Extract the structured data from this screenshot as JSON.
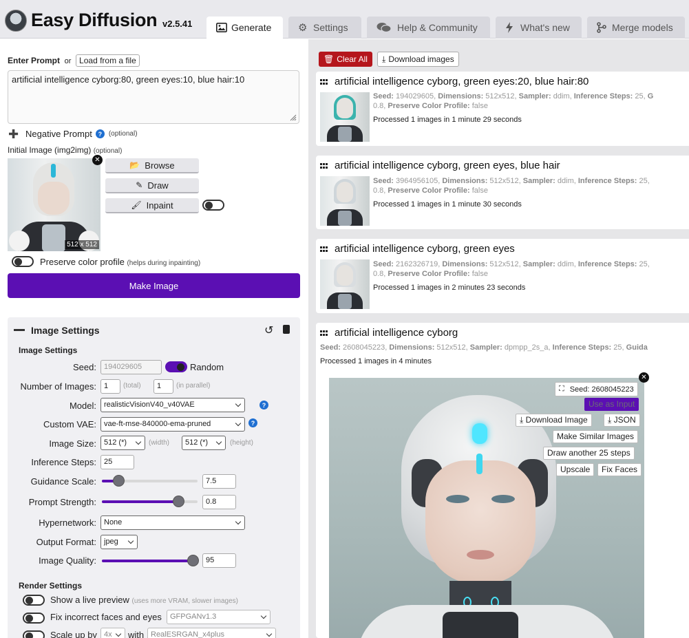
{
  "header": {
    "app_title": "Easy Diffusion",
    "version": "v2.5.41",
    "tabs": [
      {
        "label": "Generate",
        "icon": "image-icon"
      },
      {
        "label": "Settings",
        "icon": "gear-icon"
      },
      {
        "label": "Help & Community",
        "icon": "comments-icon"
      },
      {
        "label": "What's new",
        "icon": "bolt-icon"
      },
      {
        "label": "Merge models",
        "icon": "code-branch-icon"
      }
    ]
  },
  "prompt": {
    "label": "Enter Prompt",
    "or": "or",
    "load_button": "Load from a file",
    "value": "artificial intelligence cyborg:80, green eyes:10, blue hair:10",
    "negative_label": "Negative Prompt",
    "negative_hint": "(optional)"
  },
  "initial_image": {
    "label": "Initial Image (img2img)",
    "hint": "(optional)",
    "size_badge": "512 x 512",
    "browse": "Browse",
    "draw": "Draw",
    "inpaint": "Inpaint",
    "preserve_label": "Preserve color profile",
    "preserve_hint": "(helps during inpainting)"
  },
  "make_image": "Make Image",
  "image_settings": {
    "panel_title": "Image Settings",
    "section_title": "Image Settings",
    "seed_label": "Seed:",
    "seed_value": "194029605",
    "random_label": "Random",
    "num_images_label": "Number of Images:",
    "num_total": "1",
    "num_total_hint": "(total)",
    "num_parallel": "1",
    "num_parallel_hint": "(in parallel)",
    "model_label": "Model:",
    "model_value": "realisticVisionV40_v40VAE",
    "vae_label": "Custom VAE:",
    "vae_value": "vae-ft-mse-840000-ema-pruned",
    "size_label": "Image Size:",
    "width_value": "512 (*)",
    "width_hint": "(width)",
    "height_value": "512 (*)",
    "height_hint": "(height)",
    "steps_label": "Inference Steps:",
    "steps_value": "25",
    "guidance_label": "Guidance Scale:",
    "guidance_value": "7.5",
    "guidance_fraction": 0.17,
    "strength_label": "Prompt Strength:",
    "strength_value": "0.8",
    "strength_fraction": 0.8,
    "hypernetwork_label": "Hypernetwork:",
    "hypernetwork_value": "None",
    "format_label": "Output Format:",
    "format_value": "jpeg",
    "quality_label": "Image Quality:",
    "quality_value": "95",
    "quality_fraction": 0.95
  },
  "render_settings": {
    "title": "Render Settings",
    "live_preview_label": "Show a live preview",
    "live_preview_hint": "(uses more VRAM, slower images)",
    "fix_faces_label": "Fix incorrect faces and eyes",
    "fix_faces_model": "GFPGANv1.3",
    "scale_label": "Scale up by",
    "scale_value": "4x",
    "scale_with": "with",
    "scale_model": "RealESRGAN_x4plus"
  },
  "results_toolbar": {
    "clear_all": "Clear All",
    "download_images": "Download images"
  },
  "results": [
    {
      "title": "artificial intelligence cyborg, green eyes:20, blue hair:80",
      "seed": "194029605",
      "dimensions": "512x512",
      "sampler": "ddim",
      "steps": "25",
      "guidance_trunc": "G",
      "strength_tail": "0.8",
      "preserve": "false",
      "processed": "Processed 1 images in 1 minute 29 seconds",
      "hair_color": "#3bb3ad"
    },
    {
      "title": "artificial intelligence cyborg, green eyes, blue hair",
      "seed": "3964956105",
      "dimensions": "512x512",
      "sampler": "ddim",
      "steps": "25",
      "guidance_trunc": "",
      "strength_tail": "0.8",
      "preserve": "false",
      "processed": "Processed 1 images in 1 minute 30 seconds",
      "hair_color": "#cfd6da"
    },
    {
      "title": "artificial intelligence cyborg, green eyes",
      "seed": "2162326719",
      "dimensions": "512x512",
      "sampler": "ddim",
      "steps": "25",
      "guidance_trunc": "",
      "strength_tail": "0.8",
      "preserve": "false",
      "processed": "Processed 1 images in 2 minutes 23 seconds",
      "hair_color": "#d9dde0"
    },
    {
      "title": "artificial intelligence cyborg",
      "seed": "2608045223",
      "dimensions": "512x512",
      "sampler": "dpmpp_2s_a",
      "steps": "25",
      "guidance_trunc": "Guida",
      "processed": "Processed 1 images in 4 minutes"
    }
  ],
  "meta_labels": {
    "seed": "Seed:",
    "dimensions": "Dimensions:",
    "sampler": "Sampler:",
    "steps": "Inference Steps:",
    "preserve": "Preserve Color Profile:"
  },
  "big_image_actions": {
    "seed_badge": "Seed: 2608045223",
    "use_as_input": "Use as Input",
    "download_image": "Download Image",
    "json": "JSON",
    "make_similar": "Make Similar Images",
    "draw_more": "Draw another 25 steps",
    "upscale": "Upscale",
    "fix_faces": "Fix Faces"
  },
  "colors": {
    "accent": "#5b0fb3",
    "clear_red": "#b5161c",
    "help_blue": "#1f6fd1"
  }
}
